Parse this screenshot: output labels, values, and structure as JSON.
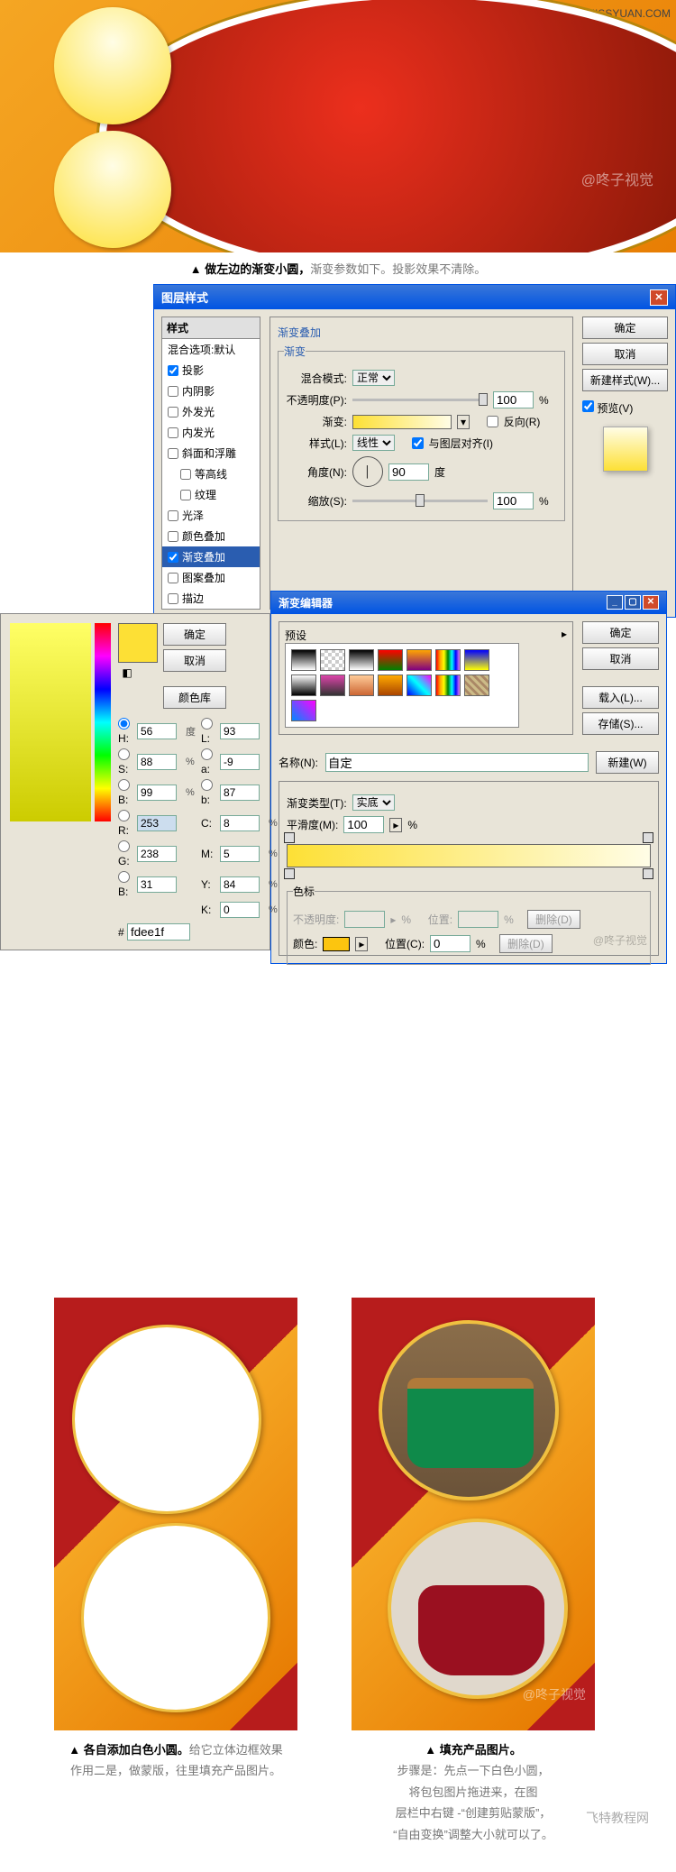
{
  "top_watermark": "思缘设计论坛  WWW.MISSYUAN.COM",
  "banner": {
    "watermark": "@咚子视觉"
  },
  "caption1": {
    "bold": "▲ 做左边的渐变小圆，",
    "grey": "渐变参数如下。投影效果不清除。"
  },
  "layerStyle": {
    "title": "图层样式",
    "stylesHeader": "样式",
    "items": [
      {
        "label": "混合选项:默认",
        "checked": false,
        "header": true
      },
      {
        "label": "投影",
        "checked": true
      },
      {
        "label": "内阴影",
        "checked": false
      },
      {
        "label": "外发光",
        "checked": false
      },
      {
        "label": "内发光",
        "checked": false
      },
      {
        "label": "斜面和浮雕",
        "checked": false
      },
      {
        "label": "等高线",
        "checked": false,
        "indent": true
      },
      {
        "label": "纹理",
        "checked": false,
        "indent": true
      },
      {
        "label": "光泽",
        "checked": false
      },
      {
        "label": "颜色叠加",
        "checked": false
      },
      {
        "label": "渐变叠加",
        "checked": true,
        "selected": true
      },
      {
        "label": "图案叠加",
        "checked": false
      },
      {
        "label": "描边",
        "checked": false
      }
    ],
    "groupTitle": "渐变叠加",
    "subGroup": "渐变",
    "blendModeLabel": "混合模式:",
    "blendMode": "正常",
    "opacityLabel": "不透明度(P):",
    "opacity": "100",
    "pct": "%",
    "gradientLabel": "渐变:",
    "reverseLabel": "反向(R)",
    "styleLabel": "样式(L):",
    "styleVal": "线性",
    "alignLabel": "与图层对齐(I)",
    "angleLabel": "角度(N):",
    "angle": "90",
    "degree": "度",
    "scaleLabel": "缩放(S):",
    "scale": "100",
    "buttons": {
      "ok": "确定",
      "cancel": "取消",
      "newStyle": "新建样式(W)...",
      "preview": "预览(V)"
    }
  },
  "gradEditor": {
    "title": "渐变编辑器",
    "presetsLabel": "预设",
    "nameLabel": "名称(N):",
    "name": "自定",
    "newBtn": "新建(W)",
    "typeLabel": "渐变类型(T):",
    "typeVal": "实底",
    "smoothLabel": "平滑度(M):",
    "smooth": "100",
    "pct": "%",
    "stopGroup": "色标",
    "opacityStopLabel": "不透明度:",
    "opacityStopPct": "%",
    "posLabel": "位置:",
    "posPct": "%",
    "del1": "删除(D)",
    "colorLabel": "颜色:",
    "posLabel2": "位置(C):",
    "pos2": "0",
    "del2": "删除(D)",
    "buttons": {
      "ok": "确定",
      "cancel": "取消",
      "load": "载入(L)...",
      "save": "存储(S)..."
    },
    "wm": "@咚子视觉"
  },
  "colorPicker": {
    "buttons": {
      "ok": "确定",
      "cancel": "取消",
      "lib": "颜色库"
    },
    "H": {
      "l": "H:",
      "v": "56",
      "u": "度"
    },
    "S": {
      "l": "S:",
      "v": "88",
      "u": "%"
    },
    "Bv": {
      "l": "B:",
      "v": "99",
      "u": "%"
    },
    "R": {
      "l": "R:",
      "v": "253"
    },
    "G": {
      "l": "G:",
      "v": "238"
    },
    "Bc": {
      "l": "B:",
      "v": "31"
    },
    "L": {
      "l": "L:",
      "v": "93"
    },
    "a": {
      "l": "a:",
      "v": "-9"
    },
    "b": {
      "l": "b:",
      "v": "87"
    },
    "C": {
      "l": "C:",
      "v": "8",
      "u": "%"
    },
    "M": {
      "l": "M:",
      "v": "5",
      "u": "%"
    },
    "Y": {
      "l": "Y:",
      "v": "84",
      "u": "%"
    },
    "K": {
      "l": "K:",
      "v": "0",
      "u": "%"
    },
    "hexLabel": "#",
    "hex": "fdee1f"
  },
  "bottom": {
    "left": {
      "l1b": "▲ 各自添加白色小圆。",
      "l1g": "给它立体边框效果",
      "l2": "作用二是，做蒙版，往里填充产品图片。"
    },
    "right": {
      "l1": "▲ 填充产品图片。",
      "l2": "步骤是：先点一下白色小圆，",
      "l3": "将包包图片拖进来，在图",
      "l4": "层栏中右键 -“创建剪贴蒙版”，",
      "l5": "“自由变换”调整大小就可以了。",
      "wm": "@咚子视觉"
    },
    "footerWm": "飞特教程网"
  }
}
